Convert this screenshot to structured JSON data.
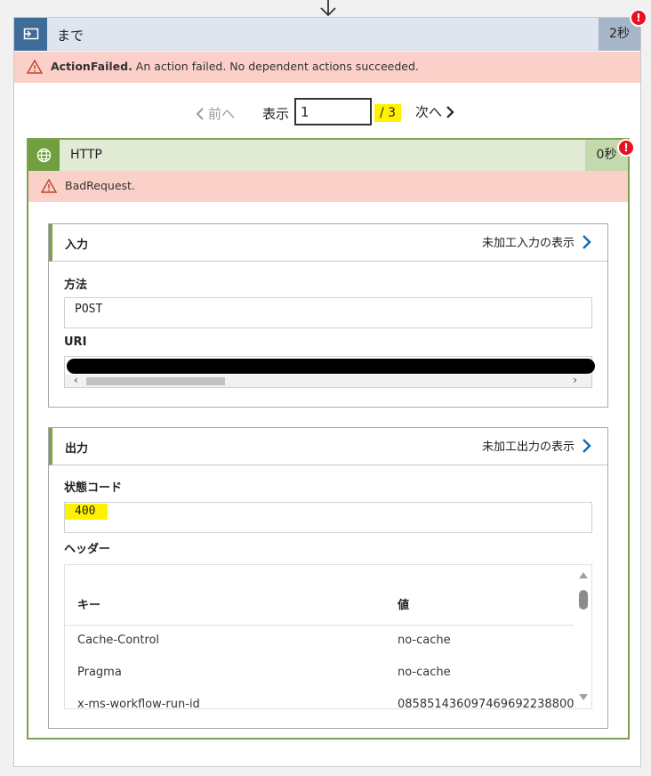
{
  "until": {
    "title": "まで",
    "duration": "2秒",
    "error_badge": "!",
    "error_code": "ActionFailed.",
    "error_message": " An action failed. No dependent actions succeeded."
  },
  "pager": {
    "prev_label": "前へ",
    "show_label": "表示",
    "current_value": "1",
    "total": "/ 3",
    "next_label": "次へ"
  },
  "http": {
    "title": "HTTP",
    "duration": "0秒",
    "error_badge": "!",
    "error_code": "BadRequest."
  },
  "inputs": {
    "title": "入力",
    "raw_link": "未加工入力の表示",
    "method_label": "方法",
    "method_value": "POST",
    "uri_label": "URI"
  },
  "outputs": {
    "title": "出力",
    "raw_link": "未加工出力の表示",
    "status_label": "状態コード",
    "status_value": "400",
    "headers_label": "ヘッダー",
    "headers_col_key": "キー",
    "headers_col_value": "値",
    "headers_rows": [
      {
        "key": "Cache-Control",
        "value": "no-cache"
      },
      {
        "key": "Pragma",
        "value": "no-cache"
      },
      {
        "key": "x-ms-workflow-run-id",
        "value": "08585143609746969223880​0..."
      }
    ]
  },
  "colors": {
    "until_icon_bg": "#3f6b98",
    "http_icon_bg": "#709f3d",
    "http_border": "#7fa051",
    "error_bg": "#fbd0c8",
    "highlight": "#fff200",
    "badge_red": "#e81123",
    "link_chevron": "#1068b8"
  },
  "icons": {
    "top_arrow": "arrow-down-icon",
    "until": "loop-until-icon",
    "http": "globe-icon",
    "warning": "warning-triangle-icon",
    "chevron_link": "chevron-right-icon"
  }
}
